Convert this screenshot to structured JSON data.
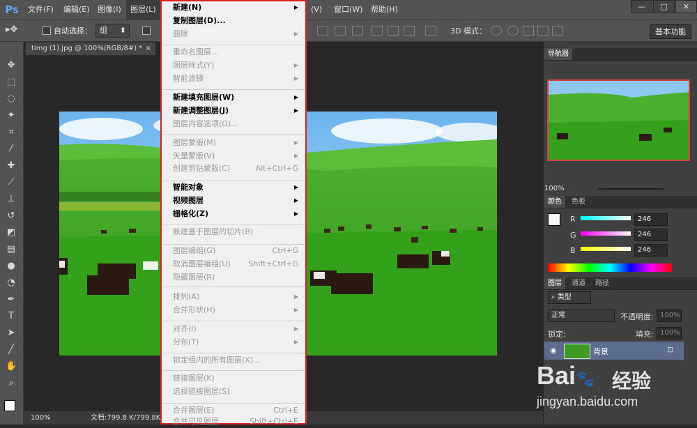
{
  "app": {
    "logo": "Ps"
  },
  "menubar": {
    "items": [
      "文件(F)",
      "编辑(E)",
      "图像(I)",
      "图层(L)",
      "(V)",
      "窗口(W)",
      "帮助(H)"
    ]
  },
  "window_controls": {
    "minimize": "—",
    "maximize": "□",
    "close": "✕"
  },
  "options": {
    "auto_select_label": "自动选择：",
    "auto_select_value": "组",
    "mode3d_label": "3D 模式：",
    "workspace_button": "基本功能"
  },
  "document": {
    "tab_title": "timg (1).jpg @ 100%(RGB/8#) *",
    "tab_close": "×",
    "zoom": "100%",
    "doc_size": "文档:799.8 K/799.8K"
  },
  "panels": {
    "navigator": {
      "tab": "导航器",
      "zoom": "100%"
    },
    "color": {
      "tabs": [
        "颜色",
        "色板"
      ],
      "r_label": "R",
      "g_label": "G",
      "b_label": "B",
      "r_value": "246",
      "g_value": "246",
      "b_value": "246"
    },
    "layers": {
      "tabs": [
        "图层",
        "通道",
        "路径"
      ],
      "filter": "类型",
      "blend_mode": "正常",
      "opacity_label": "不透明度:",
      "opacity_value": "100%",
      "lock_label": "锁定:",
      "fill_label": "填充:",
      "fill_value": "100%",
      "layer_name": "背景"
    }
  },
  "layer_menu": {
    "items": [
      {
        "label": "新建(N)",
        "enabled": true,
        "arrow": true
      },
      {
        "label": "复制图层(D)...",
        "enabled": true
      },
      {
        "label": "删除",
        "enabled": false,
        "arrow": true
      },
      {
        "label": "重命名图层...",
        "enabled": false
      },
      {
        "label": "图层样式(Y)",
        "enabled": false,
        "arrow": true
      },
      {
        "label": "智能滤镜",
        "enabled": false,
        "arrow": true
      },
      {
        "label": "新建填充图层(W)",
        "enabled": true,
        "arrow": true
      },
      {
        "label": "新建调整图层(J)",
        "enabled": true,
        "arrow": true
      },
      {
        "label": "图层内容选项(O)...",
        "enabled": false
      },
      {
        "label": "图层蒙版(M)",
        "enabled": false,
        "arrow": true
      },
      {
        "label": "矢量蒙版(V)",
        "enabled": false,
        "arrow": true
      },
      {
        "label": "创建剪贴蒙版(C)",
        "enabled": false,
        "shortcut": "Alt+Ctrl+G"
      },
      {
        "label": "智能对象",
        "enabled": true,
        "arrow": true
      },
      {
        "label": "视频图层",
        "enabled": true,
        "arrow": true
      },
      {
        "label": "栅格化(Z)",
        "enabled": true,
        "arrow": true
      },
      {
        "label": "新建基于图层的切片(B)",
        "enabled": false
      },
      {
        "label": "图层编组(G)",
        "enabled": false,
        "shortcut": "Ctrl+G"
      },
      {
        "label": "取消图层编组(U)",
        "enabled": false,
        "shortcut": "Shift+Ctrl+G"
      },
      {
        "label": "隐藏图层(R)",
        "enabled": false
      },
      {
        "label": "排列(A)",
        "enabled": false,
        "arrow": true
      },
      {
        "label": "合并形状(H)",
        "enabled": false,
        "arrow": true
      },
      {
        "label": "对齐(I)",
        "enabled": false,
        "arrow": true
      },
      {
        "label": "分布(T)",
        "enabled": false,
        "arrow": true
      },
      {
        "label": "锁定组内的所有图层(X)...",
        "enabled": false
      },
      {
        "label": "链接图层(K)",
        "enabled": false
      },
      {
        "label": "选择链接图层(S)",
        "enabled": false
      },
      {
        "label": "合并图层(E)",
        "enabled": false,
        "shortcut": "Ctrl+E"
      },
      {
        "label": "合并可见图层",
        "enabled": false,
        "shortcut": "Shift+Ctrl+E"
      }
    ]
  },
  "watermark": {
    "brand": "Bai",
    "paw": "du",
    "cn": "经验",
    "url": "jingyan.baidu.com"
  },
  "colors": {
    "menu_border": "#e02020",
    "accent": "#5aa8ff"
  }
}
